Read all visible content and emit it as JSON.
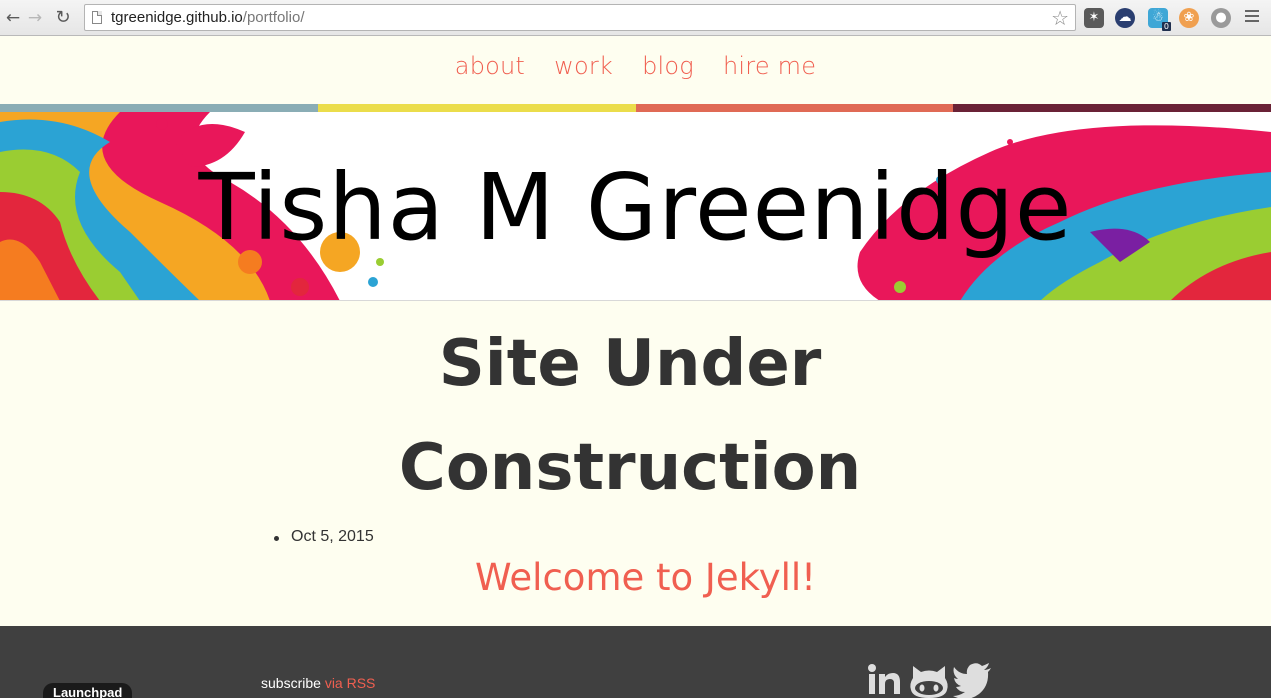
{
  "browser": {
    "url_host": "tgreenidge.github.io",
    "url_path": "/portfolio/",
    "back_glyph": "←",
    "forward_glyph": "→",
    "reload_glyph": "↻",
    "star_glyph": "☆",
    "extensions": [
      {
        "name": "evernote-icon",
        "color": "#5a5a5a",
        "glyph": "✶"
      },
      {
        "name": "cloud-icon",
        "color": "#2a3e70",
        "glyph": "☁"
      },
      {
        "name": "ghostery-icon",
        "color": "#3fa7d6",
        "glyph": "☃",
        "badge": "0"
      },
      {
        "name": "pocket-icon",
        "color": "#f0a050",
        "glyph": "❀"
      },
      {
        "name": "globe-icon",
        "color": "#9a9a9a",
        "glyph": "●"
      }
    ]
  },
  "nav": {
    "items": [
      {
        "label": "about"
      },
      {
        "label": "work"
      },
      {
        "label": "blog"
      },
      {
        "label": "hire me"
      }
    ]
  },
  "stripe_colors": [
    "#8aadb5",
    "#ebdd4b",
    "#e06a55",
    "#6a2236"
  ],
  "header": {
    "site_title": "Tisha M Greenidge"
  },
  "post": {
    "title": "Site Under Construction",
    "date": "Oct 5, 2015",
    "link_text": "Welcome to Jekyll!"
  },
  "footer": {
    "badge": "Launchpad",
    "subscribe_text": "subscribe",
    "rss_link": "via RSS",
    "social": [
      "linkedin-icon",
      "github-icon",
      "twitter-icon"
    ]
  },
  "colors": {
    "accent": "#f05f50",
    "background": "#fefef0",
    "footer_bg": "#404040"
  }
}
